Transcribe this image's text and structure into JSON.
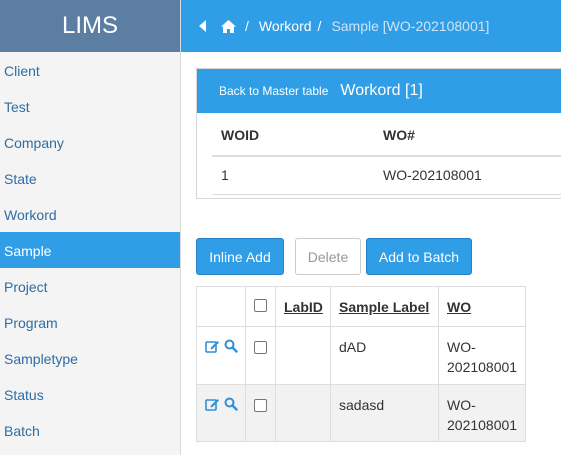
{
  "app": {
    "title": "LIMS"
  },
  "sidebar": {
    "items": [
      {
        "label": "Client",
        "active": false
      },
      {
        "label": "Test",
        "active": false
      },
      {
        "label": "Company",
        "active": false
      },
      {
        "label": "State",
        "active": false
      },
      {
        "label": "Workord",
        "active": false
      },
      {
        "label": "Sample",
        "active": true
      },
      {
        "label": "Project",
        "active": false
      },
      {
        "label": "Program",
        "active": false
      },
      {
        "label": "Sampletype",
        "active": false
      },
      {
        "label": "Status",
        "active": false
      },
      {
        "label": "Batch",
        "active": false
      }
    ]
  },
  "breadcrumb": {
    "back_icon": "chevron-left-icon",
    "home_icon": "home-icon",
    "separator": "/",
    "parent": "Workord",
    "current": "Sample [WO-202108001]"
  },
  "master": {
    "back_label": "Back to Master table",
    "title": "Workord [1]",
    "headers": [
      "WOID",
      "WO#"
    ],
    "rows": [
      [
        "1",
        "WO-202108001"
      ]
    ]
  },
  "toolbar": {
    "inline_add": "Inline Add",
    "delete": "Delete",
    "add_to_batch": "Add to Batch"
  },
  "samples": {
    "headers": {
      "labid": "LabID",
      "sample_label": "Sample Label",
      "wo": "WO"
    },
    "rows": [
      {
        "labid": "",
        "sample_label": "dAD",
        "wo": "WO-202108001",
        "checked": false
      },
      {
        "labid": "",
        "sample_label": "sadasd",
        "wo": "WO-202108001",
        "checked": false
      }
    ],
    "row_icons": [
      "edit-icon",
      "search-icon"
    ]
  },
  "colors": {
    "accent": "#2f9ee6",
    "brand_bg": "#5d7ea3",
    "link": "#2e6da4",
    "sidebar_bg": "#f4f4f4"
  }
}
